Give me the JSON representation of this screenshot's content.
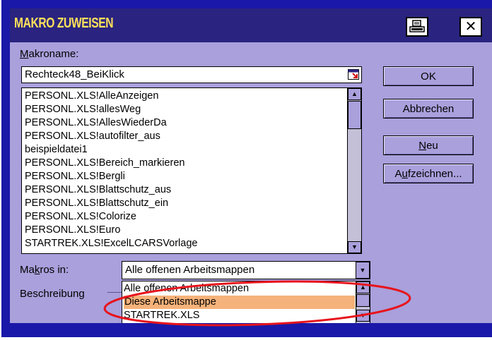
{
  "window": {
    "title": "MAKRO ZUWEISEN"
  },
  "title_buttons": {
    "print_icon": "printer-icon",
    "close_glyph": "✕"
  },
  "macro_name": {
    "label_u": "M",
    "label_rest": "akroname:",
    "value": "Rechteck48_BeiKlick",
    "picker_icon": "select-range-icon"
  },
  "macro_list": {
    "items": [
      "PERSONL.XLS!AlleAnzeigen",
      "PERSONL.XLS!allesWeg",
      "PERSONL.XLS!AllesWiederDa",
      "PERSONL.XLS!autofilter_aus",
      "beispieldatei1",
      "PERSONL.XLS!Bereich_markieren",
      "PERSONL.XLS!Bergli",
      "PERSONL.XLS!Blattschutz_aus",
      "PERSONL.XLS!Blattschutz_ein",
      "PERSONL.XLS!Colorize",
      "PERSONL.XLS!Euro",
      "STARTREK.XLS!ExcelLCARSVorlage"
    ],
    "scroll_up": "▲",
    "scroll_down": "▼"
  },
  "buttons": {
    "ok": "OK",
    "cancel": "Abbrechen",
    "new_u": "N",
    "new_rest": "eu",
    "record_pre": "A",
    "record_u": "u",
    "record_rest": "fzeichnen..."
  },
  "macros_in": {
    "label_pre": "Ma",
    "label_u": "k",
    "label_rest": "ros in:",
    "selected": "Alle offenen Arbeitsmappen",
    "arrow": "▼",
    "options": [
      "Alle offenen Arbeitsmappen",
      "Diese Arbeitsmappe",
      "STARTREK.XLS"
    ]
  },
  "description": {
    "label": "Beschreibung"
  },
  "annotation": {
    "ellipse_color": "#e8141c",
    "highlight_color": "#f5b27a"
  }
}
